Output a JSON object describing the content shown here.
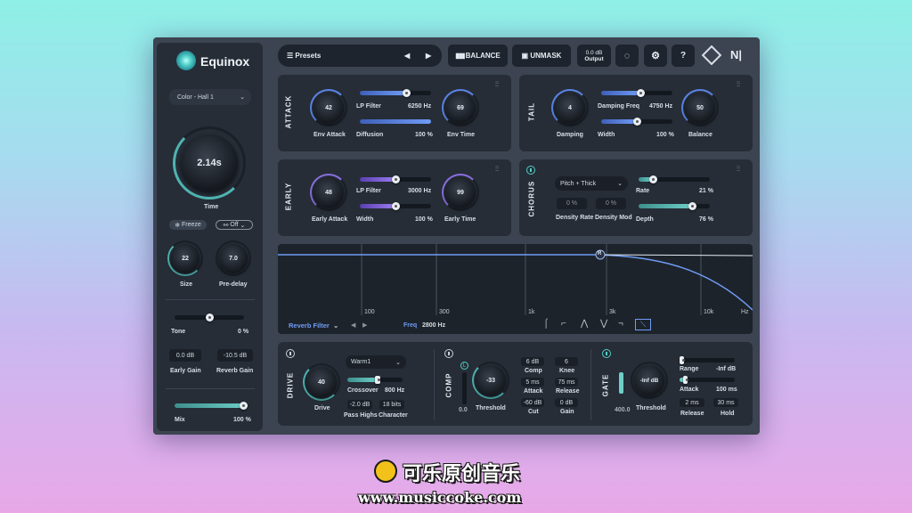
{
  "app": {
    "name": "Equinox"
  },
  "sidebar": {
    "preset_select": "Color - Hall 1",
    "time_value": "2.14s",
    "time_label": "Time",
    "freeze_label": "Freeze",
    "lock_label": "Off",
    "size_value": "22",
    "size_label": "Size",
    "predelay_value": "7.0",
    "predelay_label": "Pre-delay",
    "tone_label": "Tone",
    "tone_value": "0 %",
    "tone_level": 0.5,
    "early_gain_value": "0.0 dB",
    "early_gain_label": "Early Gain",
    "reverb_gain_value": "-10.5 dB",
    "reverb_gain_label": "Reverb Gain",
    "mix_label": "Mix",
    "mix_value": "100 %",
    "mix_level": 1.0
  },
  "toolbar": {
    "presets_label": "Presets",
    "balance_label": "BALANCE",
    "unmask_label": "UNMASK",
    "output_value": "0.0 dB",
    "output_label": "Output"
  },
  "attack": {
    "title": "ATTACK",
    "env_attack_value": "42",
    "env_attack_label": "Env Attack",
    "lp_filter_label": "LP Filter",
    "lp_filter_value": "6250 Hz",
    "lp_filter_level": 0.65,
    "diffusion_label": "Diffusion",
    "diffusion_value": "100 %",
    "diffusion_level": 1.0,
    "env_time_value": "69",
    "env_time_label": "Env Time"
  },
  "tail": {
    "title": "TAIL",
    "damping_value": "4",
    "damping_label": "Damping",
    "damping_freq_label": "Damping Freq",
    "damping_freq_value": "4750 Hz",
    "damping_freq_level": 0.55,
    "width_label": "Width",
    "width_value": "100 %",
    "width_level": 0.5,
    "balance_value": "50",
    "balance_label": "Balance"
  },
  "early": {
    "title": "EARLY",
    "early_attack_value": "48",
    "early_attack_label": "Early Attack",
    "lp_filter_label": "LP Filter",
    "lp_filter_value": "3000 Hz",
    "lp_filter_level": 0.5,
    "width_label": "Width",
    "width_value": "100 %",
    "width_level": 0.5,
    "early_time_value": "99",
    "early_time_label": "Early Time"
  },
  "chorus": {
    "title": "CHORUS",
    "mode_select": "Pitch + Thick",
    "density_rate_value": "0 %",
    "density_rate_label": "Density Rate",
    "density_mod_value": "0 %",
    "density_mod_label": "Density Mod",
    "rate_label": "Rate",
    "rate_value": "21 %",
    "rate_level": 0.2,
    "depth_label": "Depth",
    "depth_value": "76 %",
    "depth_level": 0.76
  },
  "filter": {
    "selector": "Reverb Filter",
    "freq_label": "Freq",
    "freq_value": "2800 Hz",
    "node_label": "R",
    "ticks": [
      "100",
      "300",
      "1k",
      "3k",
      "10k",
      "Hz"
    ]
  },
  "drive": {
    "title": "DRIVE",
    "drive_value": "40",
    "drive_label": "Drive",
    "mode_select": "Warm1",
    "crossover_label": "Crossover",
    "crossover_value": "800 Hz",
    "crossover_level": 0.55,
    "pass_highs_value": "-2.0 dB",
    "pass_highs_label": "Pass Highs",
    "character_value": "18 bits",
    "character_label": "Character"
  },
  "comp": {
    "title": "COMP",
    "l_label": "L",
    "meter_value": "0.0",
    "threshold_value": "-33",
    "threshold_label": "Threshold",
    "comp_value": "6 dB",
    "comp_label": "Comp",
    "knee_value": "6",
    "knee_label": "Knee",
    "attack_value": "5 ms",
    "attack_label": "Attack",
    "release_value": "75 ms",
    "release_label": "Release",
    "cut_value": "-60 dB",
    "cut_label": "Cut",
    "gain_value": "0 dB",
    "gain_label": "Gain"
  },
  "gate": {
    "title": "GATE",
    "meter_value": "400.0",
    "threshold_value": "-Inf dB",
    "threshold_label": "Threshold",
    "range_label": "Range",
    "range_value": "-Inf dB",
    "range_level": 0.0,
    "attack_label": "Attack",
    "attack_value": "100 ms",
    "attack_level": 0.1,
    "release_value": "2 ms",
    "release_label": "Release",
    "hold_value": "30 ms",
    "hold_label": "Hold"
  },
  "watermark": {
    "title": "可乐原创音乐",
    "url": "www.musiccoke.com"
  },
  "colors": {
    "accent_teal": "#4fb3b0",
    "accent_blue": "#5b86e8",
    "accent_purple": "#8a6fe0",
    "panel": "#262d37"
  }
}
